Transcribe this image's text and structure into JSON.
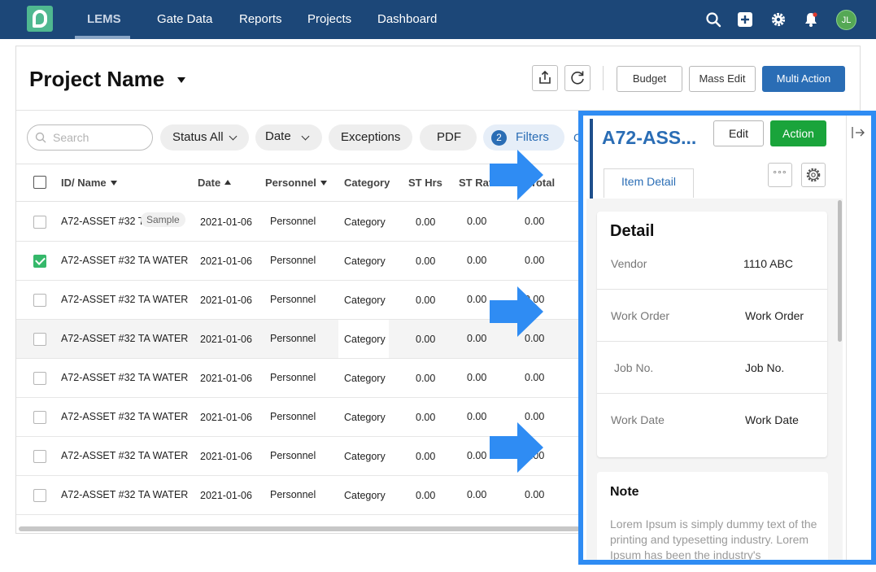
{
  "nav": {
    "items": [
      "LEMS",
      "Gate Data",
      "Reports",
      "Projects",
      "Dashboard"
    ],
    "active": "LEMS",
    "user_initials": "JL",
    "bg_color": "#1c4778",
    "icons": [
      "search-icon",
      "add-icon",
      "gear-icon",
      "bell-icon"
    ]
  },
  "header": {
    "project_title": "Project Name",
    "buttons": {
      "budget": "Budget",
      "mass_edit": "Mass Edit",
      "multi_action": "Multi Action"
    },
    "icon_buttons": [
      "export-icon",
      "refresh-icon"
    ]
  },
  "filters": {
    "search_placeholder": "Search",
    "status": "Status All",
    "date": "Date",
    "exceptions": "Exceptions",
    "pdf": "PDF",
    "filters_label": "Filters",
    "filters_count": "2",
    "clear_partial": "C"
  },
  "table": {
    "columns": [
      "ID/ Name",
      "Date",
      "Personnel",
      "Category",
      "ST Hrs",
      "ST Rat",
      "Total"
    ],
    "rows": [
      {
        "id": "A72-ASSET #32 T.",
        "tag": "Sample",
        "date": "2021-01-06",
        "personnel": "Personnel",
        "category": "Category",
        "st_hrs": "0.00",
        "st_rate": "0.00",
        "total": "0.00",
        "checked": false
      },
      {
        "id": "A72-ASSET #32 TA WATER",
        "date": "2021-01-06",
        "personnel": "Personnel",
        "category": "Category",
        "st_hrs": "0.00",
        "st_rate": "0.00",
        "total": "0.00",
        "checked": true
      },
      {
        "id": "A72-ASSET #32 TA WATER",
        "date": "2021-01-06",
        "personnel": "Personnel",
        "category": "Category",
        "st_hrs": "0.00",
        "st_rate": "0.00",
        "total": "0.00",
        "checked": false
      },
      {
        "id": "A72-ASSET #32 TA WATER",
        "date": "2021-01-06",
        "personnel": "Personnel",
        "category": "Category",
        "st_hrs": "0.00",
        "st_rate": "0.00",
        "total": "0.00",
        "checked": false
      },
      {
        "id": "A72-ASSET #32 TA WATER",
        "date": "2021-01-06",
        "personnel": "Personnel",
        "category": "Category",
        "st_hrs": "0.00",
        "st_rate": "0.00",
        "total": "0.00",
        "checked": false
      },
      {
        "id": "A72-ASSET #32 TA WATER",
        "date": "2021-01-06",
        "personnel": "Personnel",
        "category": "Category",
        "st_hrs": "0.00",
        "st_rate": "0.00",
        "total": "0.00",
        "checked": false
      },
      {
        "id": "A72-ASSET #32 TA WATER",
        "date": "2021-01-06",
        "personnel": "Personnel",
        "category": "Category",
        "st_hrs": "0.00",
        "st_rate": "0.00",
        "total": "0.00",
        "checked": false
      },
      {
        "id": "A72-ASSET #32 TA WATER",
        "date": "2021-01-06",
        "personnel": "Personnel",
        "category": "Category",
        "st_hrs": "0.00",
        "st_rate": "0.00",
        "total": "0.00",
        "checked": false
      }
    ]
  },
  "panel": {
    "title": "A72-ASS...",
    "edit": "Edit",
    "action": "Action",
    "tab": "Item Detail",
    "more_label": "°°°",
    "border_color": "#2f8cf3",
    "detail": {
      "title": "Detail",
      "fields": [
        {
          "label": "Vendor",
          "value": "1110 ABC"
        },
        {
          "label": "Work Order",
          "value": "Work Order"
        },
        {
          "label": "Job No.",
          "value": "Job No."
        },
        {
          "label": "Work Date",
          "value": "Work Date"
        }
      ]
    },
    "note": {
      "title": "Note",
      "text": "Lorem Ipsum is simply dummy text of the printing and typesetting industry. Lorem Ipsum has been the industry's"
    }
  },
  "colors": {
    "primary": "#2a6db5",
    "action_green": "#1aa43b",
    "check_green": "#35b86a",
    "highlight_arrow": "#2f8cf3"
  }
}
